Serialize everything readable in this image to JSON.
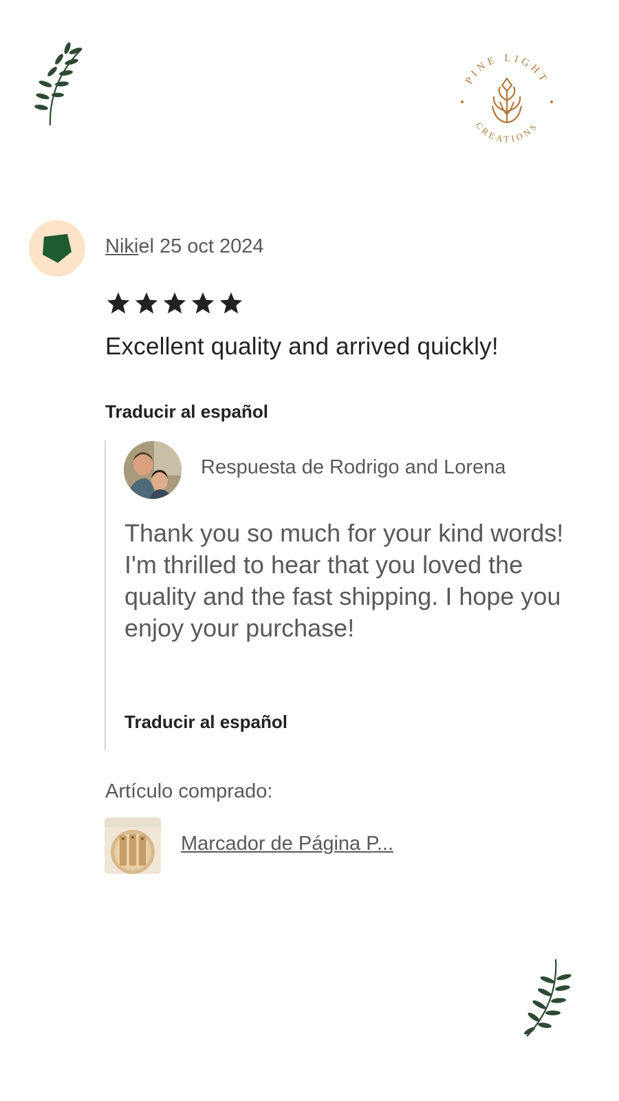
{
  "brand": {
    "logo_text_top": "PINE LIGHT",
    "logo_text_bottom": "CREATIONS",
    "accent_color": "#b07a3c",
    "leaf_color": "#2e4a34"
  },
  "review": {
    "reviewer_name": "Niki",
    "date": "el 25 oct 2024",
    "rating": 5,
    "rating_max": 5,
    "text": "Excellent quality and arrived quickly!",
    "translate_label": "Traducir al español",
    "avatar_icon": "pentagon-avatar-icon",
    "avatar_bg": "#fde3c7",
    "avatar_shape_color": "#1e5b2e"
  },
  "response": {
    "label": "Respuesta de Rodrigo and Lorena",
    "text": "Thank you so much for your kind words! I'm thrilled to hear that you loved the quality and the fast shipping. I hope you enjoy your purchase!",
    "translate_label": "Traducir al español"
  },
  "purchase": {
    "label": "Artículo comprado:",
    "item_title": "Marcador de Página P..."
  }
}
